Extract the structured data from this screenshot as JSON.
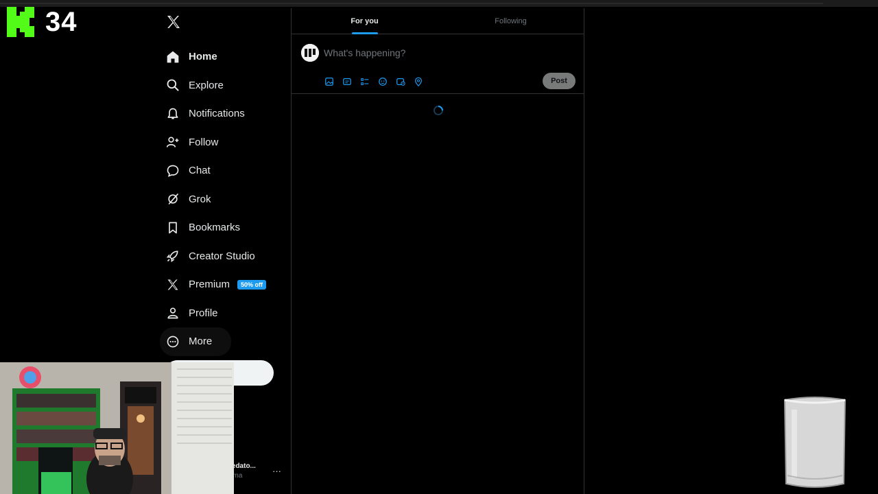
{
  "overlay": {
    "kick_count": "34"
  },
  "sidebar": {
    "items": [
      {
        "label": "Home",
        "icon": "home-icon"
      },
      {
        "label": "Explore",
        "icon": "search-icon"
      },
      {
        "label": "Notifications",
        "icon": "bell-icon"
      },
      {
        "label": "Follow",
        "icon": "follow-icon"
      },
      {
        "label": "Chat",
        "icon": "chat-icon"
      },
      {
        "label": "Grok",
        "icon": "grok-icon"
      },
      {
        "label": "Bookmarks",
        "icon": "bookmark-icon"
      },
      {
        "label": "Creator Studio",
        "icon": "rocket-icon"
      },
      {
        "label": "Premium",
        "icon": "x-icon"
      },
      {
        "label": "Profile",
        "icon": "profile-icon"
      },
      {
        "label": "More",
        "icon": "more-circle-icon"
      }
    ],
    "premium_badge": "50% off",
    "account": {
      "name": "redato...",
      "handle": "oma",
      "more": "···"
    }
  },
  "main": {
    "tabs": [
      {
        "label": "For you"
      },
      {
        "label": "Following"
      }
    ],
    "composer": {
      "placeholder": "What's happening?",
      "post_label": "Post"
    }
  },
  "colors": {
    "accent": "#1d9bf0",
    "kick_green": "#53fc18",
    "background": "#000000"
  }
}
